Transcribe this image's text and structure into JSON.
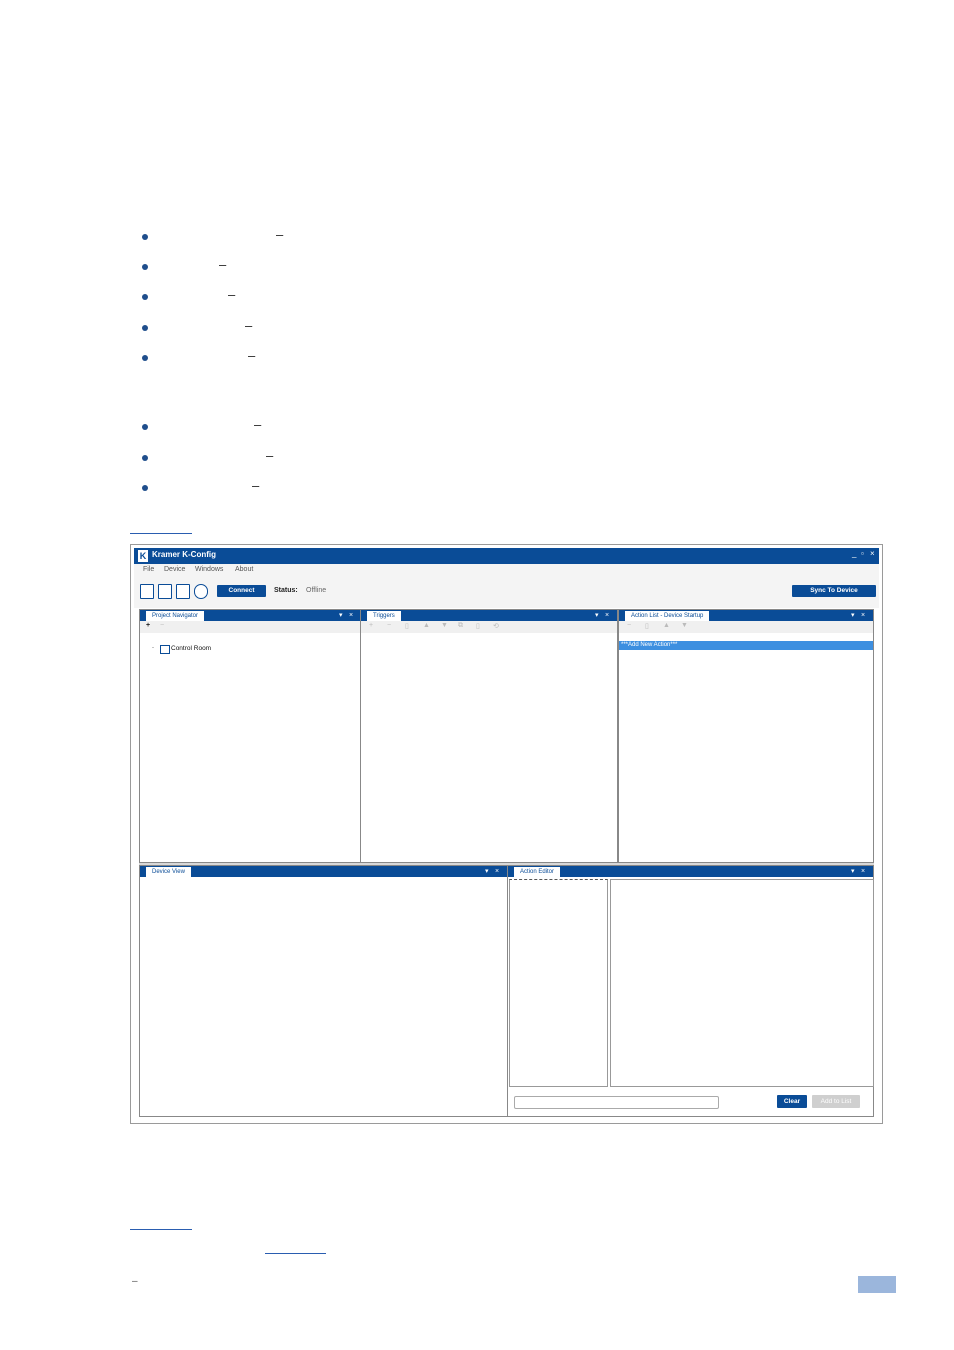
{
  "page": {
    "bullet_separators": [
      "–",
      "–",
      "–",
      "–",
      "–",
      "–",
      "–",
      "–"
    ],
    "footer_dash": "–"
  },
  "app": {
    "title": "Kramer K-Config",
    "window_controls": [
      "_",
      "▫",
      "×"
    ],
    "menu": [
      "File",
      "Device",
      "Windows",
      "About"
    ],
    "toolbar": {
      "connect_label": "Connect",
      "status_label": "Status:",
      "status_value": "Offline",
      "sync_label": "Sync To Device"
    },
    "panels": {
      "project_navigator": {
        "title": "Project Navigator",
        "tree_item": "Control Room",
        "tools": [
          "+",
          "−"
        ]
      },
      "triggers": {
        "title": "Triggers",
        "tools": [
          "+",
          "−",
          "▯",
          "▲",
          "▼",
          "⧉",
          "▯",
          "⟲"
        ]
      },
      "action_list": {
        "title": "Action List - Device Startup",
        "new_action": "***Add New Action***",
        "tools": [
          "−",
          "▯",
          "▲",
          "▼"
        ]
      },
      "device_view": {
        "title": "Device View"
      },
      "action_editor": {
        "title": "Action Editor",
        "clear_label": "Clear",
        "add_label": "Add to List"
      }
    },
    "panel_controls": [
      "▾",
      "×"
    ]
  },
  "colors": {
    "accent": "#0a4c97",
    "highlight": "#3d8fe0",
    "bullet": "#1f4e8c",
    "page_badge": "#9bb6dc"
  },
  "icons": [
    "new-file-icon",
    "open-folder-icon",
    "save-icon",
    "globe-icon",
    "kramer-logo-icon"
  ]
}
